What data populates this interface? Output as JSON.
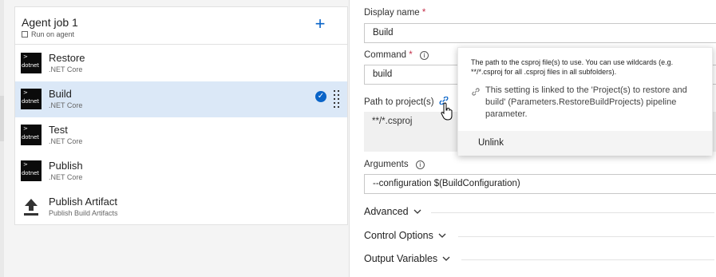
{
  "agent_job": {
    "title": "Agent job 1",
    "subtitle": "Run on agent"
  },
  "tasks": [
    {
      "name": "Restore",
      "subtitle": ".NET Core",
      "icon": "dotnet"
    },
    {
      "name": "Build",
      "subtitle": ".NET Core",
      "icon": "dotnet",
      "selected": true
    },
    {
      "name": "Test",
      "subtitle": ".NET Core",
      "icon": "dotnet"
    },
    {
      "name": "Publish",
      "subtitle": ".NET Core",
      "icon": "dotnet"
    },
    {
      "name": "Publish Artifact",
      "subtitle": "Publish Build Artifacts",
      "icon": "upload-icon"
    }
  ],
  "icon_label": "dotnet",
  "form": {
    "display_name_label": "Display name",
    "display_name_value": "Build",
    "command_label": "Command",
    "command_value": "build",
    "path_label": "Path to project(s)",
    "path_value": "**/*.csproj",
    "arguments_label": "Arguments",
    "arguments_value": "--configuration $(BuildConfiguration)",
    "required_mark": "*",
    "info_glyph": "i"
  },
  "sections": {
    "advanced": "Advanced",
    "control_options": "Control Options",
    "output_variables": "Output Variables"
  },
  "tooltip": {
    "description": "The path to the csproj file(s) to use. You can use wildcards (e.g. **/*.csproj for all .csproj files in all subfolders).",
    "linked_text": "This setting is linked to the 'Project(s) to restore and build' (Parameters.RestoreBuildProjects) pipeline parameter.",
    "unlink_label": "Unlink"
  },
  "colors": {
    "accent": "#0a64c8",
    "selected_row": "#dbe8f7",
    "required": "#c4314b"
  }
}
